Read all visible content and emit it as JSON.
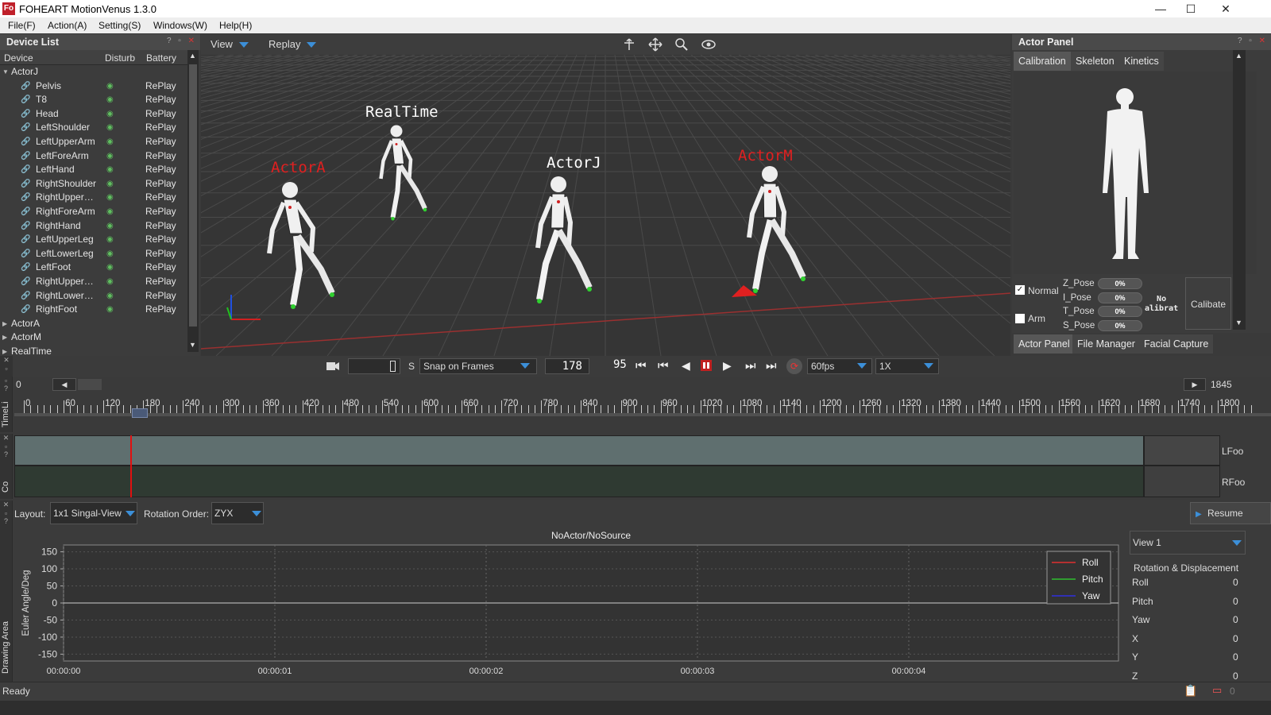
{
  "app": {
    "logo": "Fo",
    "title": "FOHEART MotionVenus  1.3.0"
  },
  "window_controls": {
    "minimize": "—",
    "maximize": "☐",
    "close": "✕"
  },
  "menu": [
    "File(F)",
    "Action(A)",
    "Setting(S)",
    "Windows(W)",
    "Help(H)"
  ],
  "device_list": {
    "title": "Device List",
    "columns": [
      "Device",
      "Disturb",
      "Battery"
    ],
    "groups": [
      {
        "name": "ActorJ",
        "expanded": true,
        "devices": [
          {
            "name": "Pelvis",
            "battery": "RePlay"
          },
          {
            "name": "T8",
            "battery": "RePlay"
          },
          {
            "name": "Head",
            "battery": "RePlay"
          },
          {
            "name": "LeftShoulder",
            "battery": "RePlay"
          },
          {
            "name": "LeftUpperArm",
            "battery": "RePlay"
          },
          {
            "name": "LeftForeArm",
            "battery": "RePlay"
          },
          {
            "name": "LeftHand",
            "battery": "RePlay"
          },
          {
            "name": "RightShoulder",
            "battery": "RePlay"
          },
          {
            "name": "RightUpper…",
            "battery": "RePlay"
          },
          {
            "name": "RightForeArm",
            "battery": "RePlay"
          },
          {
            "name": "RightHand",
            "battery": "RePlay"
          },
          {
            "name": "LeftUpperLeg",
            "battery": "RePlay"
          },
          {
            "name": "LeftLowerLeg",
            "battery": "RePlay"
          },
          {
            "name": "LeftFoot",
            "battery": "RePlay"
          },
          {
            "name": "RightUpper…",
            "battery": "RePlay"
          },
          {
            "name": "RightLower…",
            "battery": "RePlay"
          },
          {
            "name": "RightFoot",
            "battery": "RePlay"
          }
        ]
      },
      {
        "name": "ActorA",
        "expanded": false
      },
      {
        "name": "ActorM",
        "expanded": false
      },
      {
        "name": "RealTime",
        "expanded": false
      }
    ]
  },
  "viewport": {
    "view_menu": "View",
    "replay_menu": "Replay",
    "actor_labels": [
      "ActorA",
      "RealTime",
      "ActorJ",
      "ActorM"
    ],
    "label_colors": [
      "#e02020",
      "#ffffff",
      "#ffffff",
      "#e02020"
    ]
  },
  "actor_panel": {
    "title": "Actor Panel",
    "tabs": [
      "Calibration",
      "Skeleton",
      "Kinetics"
    ],
    "options": [
      {
        "label": "Normal",
        "checked": true
      },
      {
        "label": "Arm",
        "checked": false
      }
    ],
    "poses": [
      {
        "name": "Z_Pose",
        "value": "0%"
      },
      {
        "name": "I_Pose",
        "value": "0%"
      },
      {
        "name": "T_Pose",
        "value": "0%"
      },
      {
        "name": "S_Pose",
        "value": "0%"
      }
    ],
    "calib_status": [
      "No",
      "alibrat"
    ],
    "calibrate_button": "Calibate",
    "bottom_tabs": [
      "Actor Panel",
      "File Manager",
      "Facial Capture"
    ]
  },
  "transport": {
    "snap_letter": "S",
    "snap_mode": "Snap on Frames",
    "current_frame": "178",
    "frame_step": "95",
    "fps": "60fps",
    "speed": "1X"
  },
  "timeline": {
    "start": "0",
    "end": "1845",
    "ticks": [
      "0",
      "60",
      "120",
      "180",
      "240",
      "300",
      "360",
      "420",
      "480",
      "540",
      "600",
      "660",
      "720",
      "780",
      "840",
      "900",
      "960",
      "1020",
      "1080",
      "1140",
      "1200",
      "1260",
      "1320",
      "1380",
      "1440",
      "1500",
      "1560",
      "1620",
      "1680",
      "1740",
      "1800"
    ],
    "label": "TimeLi"
  },
  "curves": {
    "label": "Co",
    "tracks": [
      "LFoo",
      "RFoo"
    ]
  },
  "graph": {
    "layout_label": "Layout:",
    "layout_value": "1x1 Singal-View",
    "rotation_label": "Rotation Order:",
    "rotation_value": "ZYX",
    "resume_button": "Resume",
    "view_select": "View 1",
    "side_label": "Drawing Area",
    "props_title": "Rotation & Displacement",
    "props": [
      {
        "name": "Roll",
        "value": "0"
      },
      {
        "name": "Pitch",
        "value": "0"
      },
      {
        "name": "Yaw",
        "value": "0"
      },
      {
        "name": "X",
        "value": "0"
      },
      {
        "name": "Y",
        "value": "0"
      },
      {
        "name": "Z",
        "value": "0"
      }
    ]
  },
  "chart_data": {
    "type": "line",
    "title": "NoActor/NoSource",
    "ylabel": "Euler Angle/Deg",
    "xlabel": "",
    "ylim": [
      -170,
      170
    ],
    "yticks": [
      150,
      100,
      50,
      0,
      -50,
      -100,
      -150
    ],
    "xticks": [
      "00:00:00",
      "00:00:01",
      "00:00:02",
      "00:00:03",
      "00:00:04"
    ],
    "grid": true,
    "legend_position": "top-right",
    "series": [
      {
        "name": "Roll",
        "color": "#e03030",
        "values": []
      },
      {
        "name": "Pitch",
        "color": "#30c030",
        "values": []
      },
      {
        "name": "Yaw",
        "color": "#3030e0",
        "values": []
      }
    ]
  },
  "status": {
    "text": "Ready"
  }
}
